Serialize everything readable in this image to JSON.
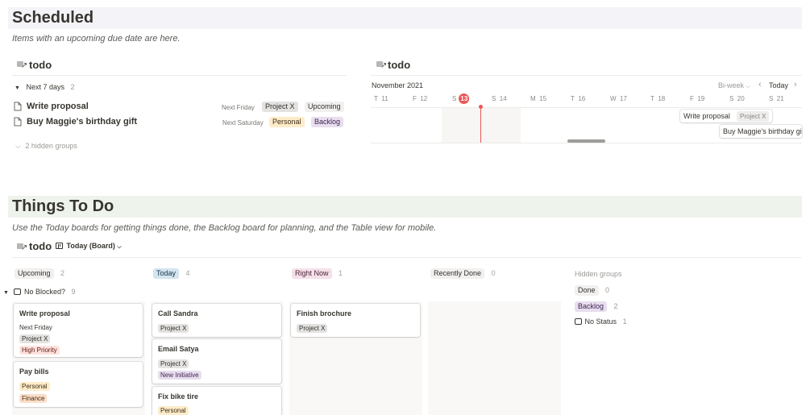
{
  "scheduled": {
    "title": "Scheduled",
    "description": "Items with an upcoming due date are here.",
    "list_db_title": "todo",
    "group_label": "Next 7 days",
    "group_count": "2",
    "items": [
      {
        "title": "Write proposal",
        "date": "Next Friday",
        "project": "Project X",
        "status": "Upcoming"
      },
      {
        "title": "Buy Maggie's birthday gift",
        "date": "Next Saturday",
        "project": "Personal",
        "status": "Backlog"
      }
    ],
    "hidden_groups": "2 hidden groups",
    "timeline": {
      "db_title": "todo",
      "month": "November 2021",
      "range": "Bi-week",
      "today_label": "Today",
      "days": [
        {
          "dow": "T",
          "num": "11"
        },
        {
          "dow": "F",
          "num": "12"
        },
        {
          "dow": "S",
          "num": "13"
        },
        {
          "dow": "S",
          "num": "14"
        },
        {
          "dow": "M",
          "num": "15"
        },
        {
          "dow": "T",
          "num": "16"
        },
        {
          "dow": "W",
          "num": "17"
        },
        {
          "dow": "T",
          "num": "18"
        },
        {
          "dow": "F",
          "num": "19"
        },
        {
          "dow": "S",
          "num": "20"
        },
        {
          "dow": "S",
          "num": "21"
        }
      ],
      "bars": [
        {
          "title": "Write proposal",
          "project": "Project X"
        },
        {
          "title": "Buy Maggie's birthday gift"
        }
      ]
    }
  },
  "things": {
    "title": "Things To Do",
    "description": "Use the Today boards for getting things done, the Backlog board for planning, and the Table view for mobile.",
    "db_title": "todo",
    "view_label": "Today (Board)",
    "columns": [
      {
        "name": "Upcoming",
        "count": "2"
      },
      {
        "name": "Today",
        "count": "4"
      },
      {
        "name": "Right Now",
        "count": "1"
      },
      {
        "name": "Recently Done",
        "count": "0"
      }
    ],
    "subgroup_label": "No Blocked?",
    "subgroup_count": "9",
    "hidden_groups_label": "Hidden groups",
    "hidden_groups": [
      {
        "name": "Done",
        "count": "0"
      },
      {
        "name": "Backlog",
        "count": "2"
      },
      {
        "name": "No Status",
        "count": "1"
      }
    ],
    "cards": {
      "write_proposal": {
        "title": "Write proposal",
        "date": "Next Friday",
        "project": "Project X",
        "priority": "High Priority"
      },
      "pay_bills": {
        "title": "Pay bills",
        "tag1": "Personal",
        "tag2": "Finance"
      },
      "call_sandra": {
        "title": "Call Sandra",
        "project": "Project X"
      },
      "email_satya": {
        "title": "Email Satya",
        "project": "Project X",
        "tag": "New Initiative"
      },
      "fix_bike": {
        "title": "Fix bike tire",
        "tag": "Personal"
      },
      "finish_brochure": {
        "title": "Finish brochure",
        "project": "Project X"
      }
    }
  },
  "colors": {
    "today_marker": "#eb5757",
    "header_band_scheduled": "#f1f1f4",
    "header_band_things": "#edf3ec"
  }
}
